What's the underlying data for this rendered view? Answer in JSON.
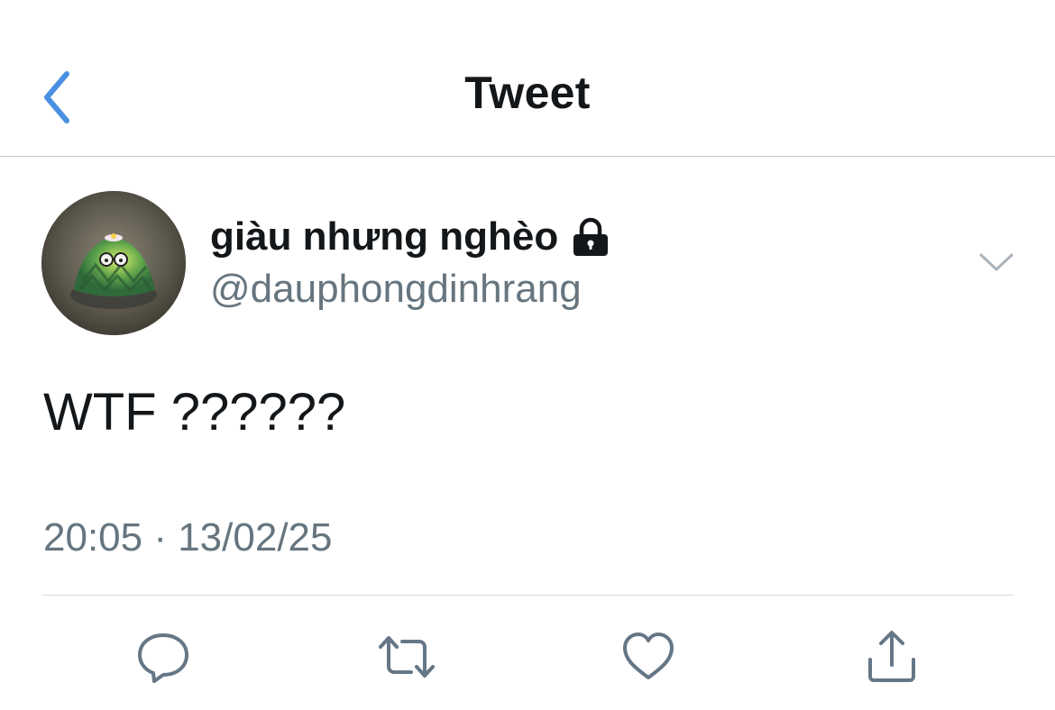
{
  "header": {
    "title": "Tweet",
    "back_icon": "chevron-left-icon",
    "accent_color": "#4a90e2"
  },
  "tweet": {
    "author": {
      "display_name": "giàu nhưng nghèo",
      "handle": "@dauphongdinhrang",
      "protected_icon": "lock-icon"
    },
    "menu_icon": "chevron-down-icon",
    "text": "WTF ??????",
    "timestamp": "20:05 · 13/02/25"
  },
  "actions": [
    {
      "name": "reply",
      "icon": "speech-bubble-icon"
    },
    {
      "name": "retweet",
      "icon": "retweet-icon"
    },
    {
      "name": "like",
      "icon": "heart-icon"
    },
    {
      "name": "share",
      "icon": "share-icon"
    }
  ],
  "colors": {
    "primary_text": "#14171a",
    "secondary_text": "#66757f",
    "icon_gray": "#657786",
    "divider": "#d6dde3"
  }
}
